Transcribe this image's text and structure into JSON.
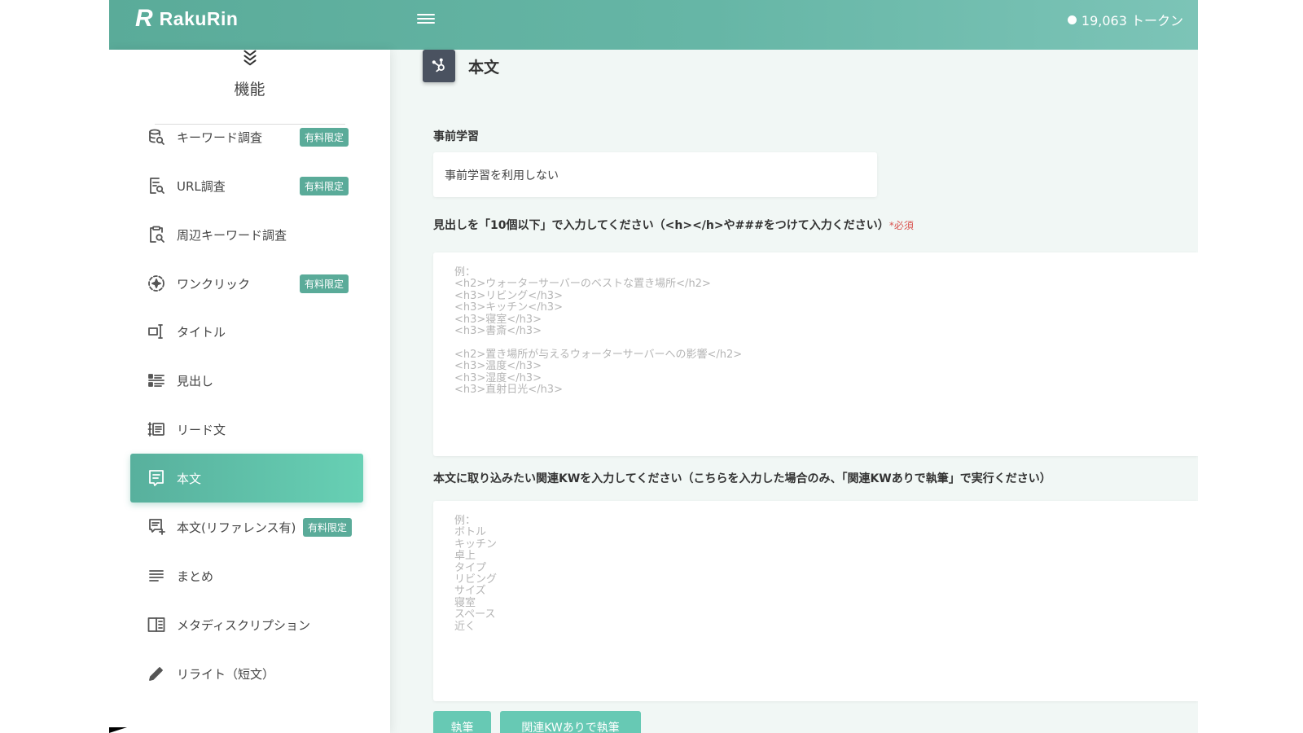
{
  "app": {
    "logo_mark": "R",
    "name": "RakuRin"
  },
  "header": {
    "tokens": "19,063 トークン"
  },
  "sidebar": {
    "title": "機能",
    "items": [
      {
        "label": "キーワード調査",
        "badge": "有料限定",
        "icon": "database-search-icon"
      },
      {
        "label": "URL調査",
        "badge": "有料限定",
        "icon": "document-search-icon"
      },
      {
        "label": "周辺キーワード調査",
        "badge": "",
        "icon": "clipboard-search-icon"
      },
      {
        "label": "ワンクリック",
        "badge": "有料限定",
        "icon": "sparkle-circle-icon"
      },
      {
        "label": "タイトル",
        "badge": "",
        "icon": "text-cursor-icon"
      },
      {
        "label": "見出し",
        "badge": "",
        "icon": "list-heading-icon"
      },
      {
        "label": "リード文",
        "badge": "",
        "icon": "numbered-list-icon"
      },
      {
        "label": "本文",
        "badge": "",
        "icon": "message-text-icon",
        "active": true
      },
      {
        "label": "本文(リファレンス有)",
        "badge": "有料限定",
        "icon": "message-plus-icon"
      },
      {
        "label": "まとめ",
        "badge": "",
        "icon": "align-left-icon"
      },
      {
        "label": "メタディスクリプション",
        "badge": "",
        "icon": "book-open-icon"
      },
      {
        "label": "リライト（短文）",
        "badge": "",
        "icon": "pencil-icon"
      }
    ]
  },
  "main": {
    "title": "本文",
    "prelearning": {
      "label": "事前学習",
      "value": "事前学習を利用しない"
    },
    "headings": {
      "label": "見出しを「10個以下」で入力してください（<h></h>や###をつけて入力ください）",
      "required": "*必須",
      "placeholder": "例：\n<h2>ウォーターサーバーのベストな置き場所</h2>\n<h3>リビング</h3>\n<h3>キッチン</h3>\n<h3>寝室</h3>\n<h3>書斎</h3>\n\n<h2>置き場所が与えるウォーターサーバーへの影響</h2>\n<h3>温度</h3>\n<h3>湿度</h3>\n<h3>直射日光</h3>"
    },
    "keywords": {
      "label": "本文に取り込みたい関連KWを入力してください（こちらを入力した場合のみ、「関連KWありで執筆」で実行ください）",
      "placeholder": "例：\nボトル\nキッチン\n卓上\nタイプ\nリビング\nサイズ\n寝室\nスペース\n近く"
    },
    "buttons": {
      "write": "執筆",
      "write_with_kw": "関連KWありで執筆"
    }
  },
  "colors": {
    "accent": "#5aab99",
    "active_gradient_end": "#67d0b4",
    "badge": "#5aab99",
    "required": "#d9534f"
  }
}
